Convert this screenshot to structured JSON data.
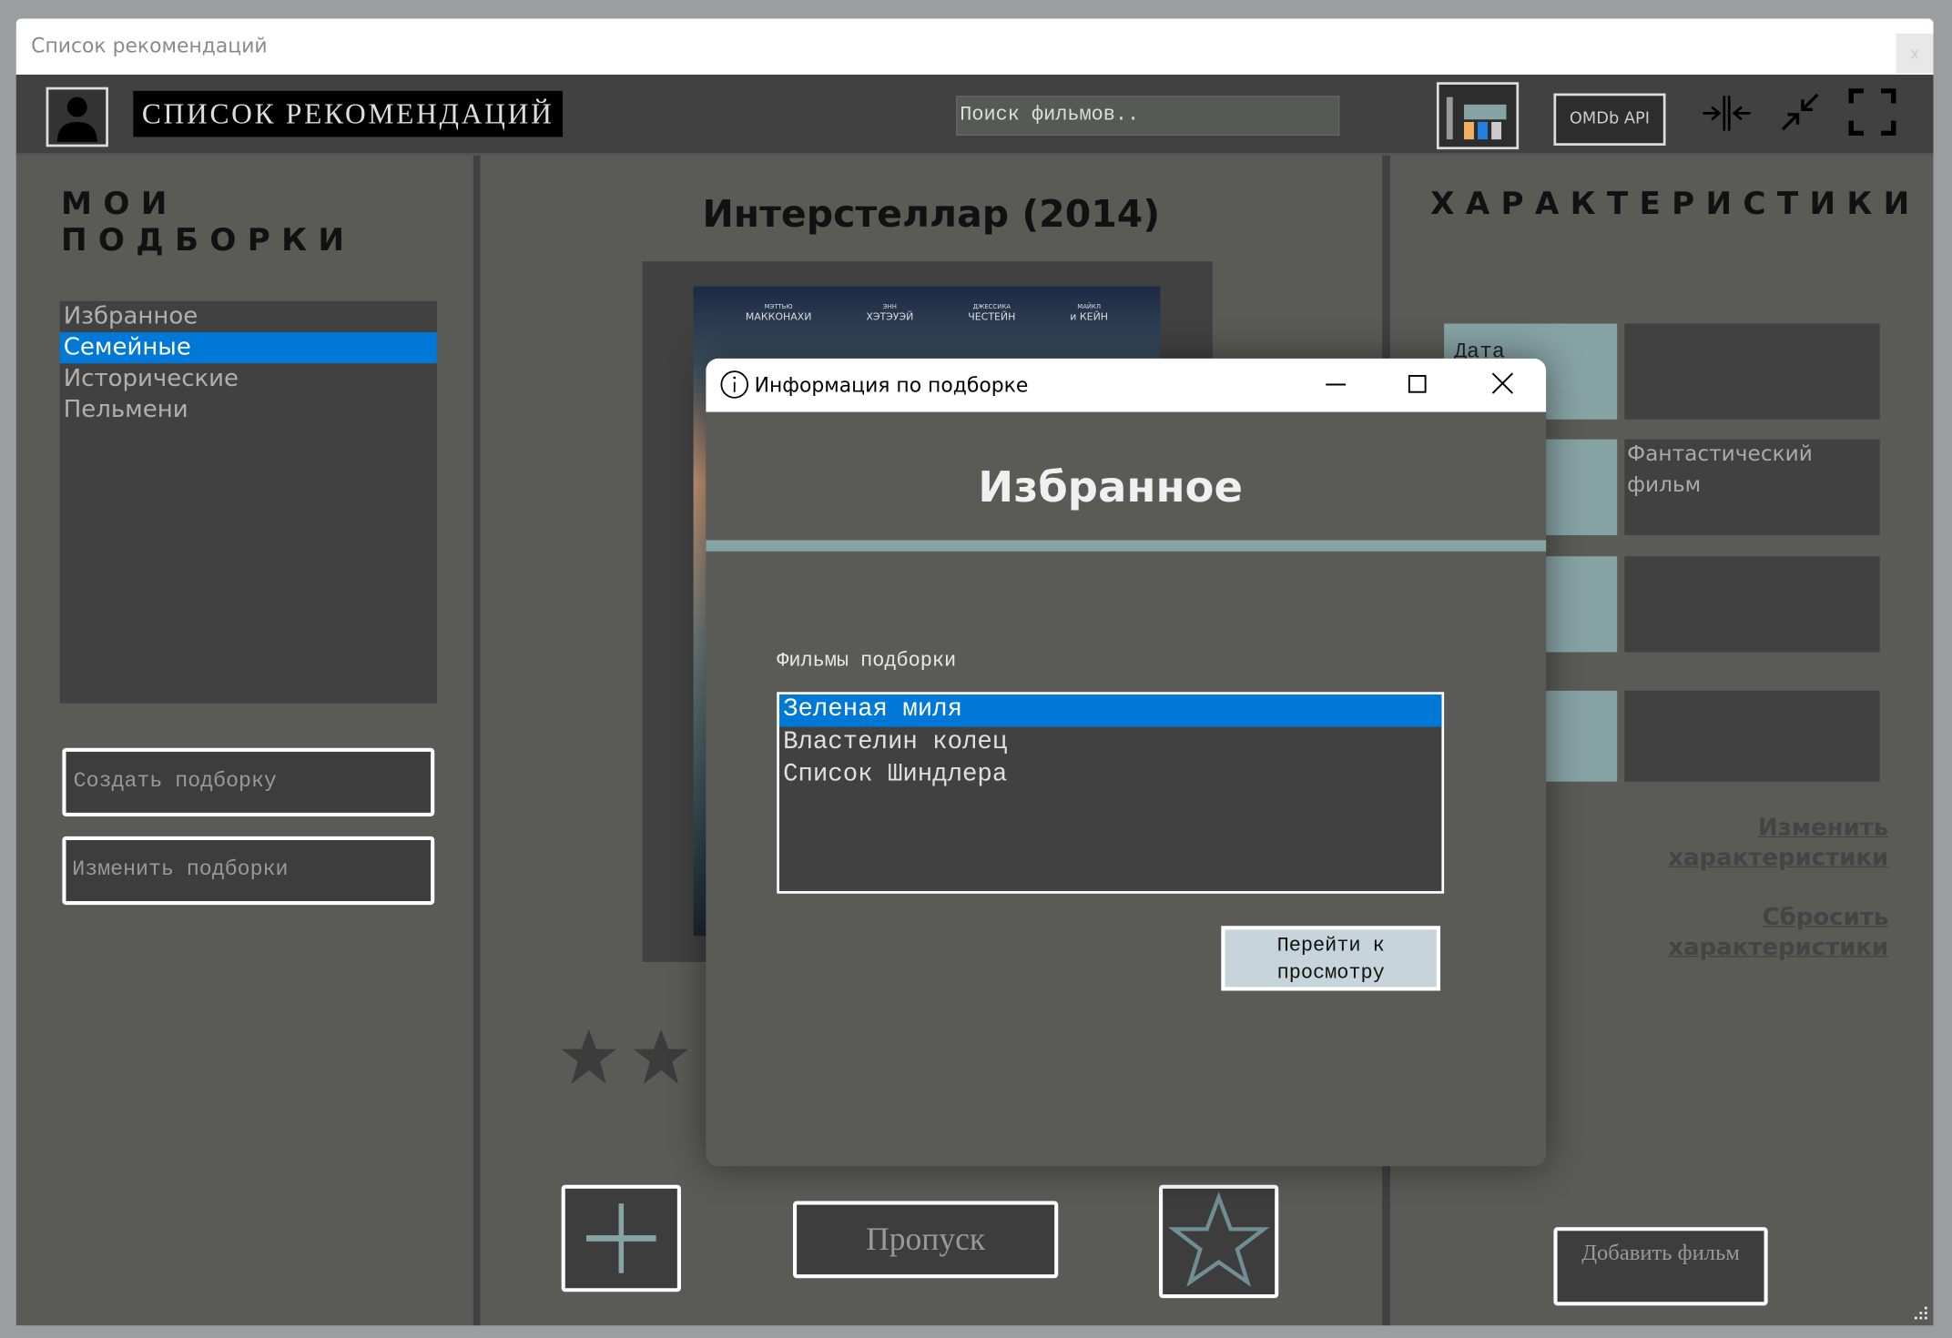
{
  "window": {
    "title": "Список рекомендаций",
    "close": "x"
  },
  "toolbar": {
    "logo": "СПИСОК РЕКОМЕНДАЦИЙ",
    "search_placeholder": "Поиск фильмов..",
    "omdb": "OMDb API"
  },
  "left": {
    "heading": "МОИ ПОДБОРКИ",
    "items": [
      "Избранное",
      "Семейные",
      "Исторические",
      "Пельмени"
    ],
    "selected": 1,
    "create": "Создать подборку",
    "edit": "Изменить подборки"
  },
  "center": {
    "title": "Интерстеллар (2014)",
    "poster_credits": [
      {
        "first": "МЭТТЬЮ",
        "last": "МАККОНАХИ"
      },
      {
        "first": "ЭНН",
        "last": "ХЭТЭУЭЙ"
      },
      {
        "first": "ДЖЕССИКА",
        "last": "ЧЕСТЕЙН"
      },
      {
        "first": "МАЙКЛ",
        "last": "и КЕЙН"
      }
    ],
    "visible_stars": 2,
    "skip": "Пропуск"
  },
  "right": {
    "heading": "ХАРАКТЕРИСТИКИ",
    "rows": [
      {
        "label": "Дата",
        "value": ""
      },
      {
        "label": "",
        "value": "Фантастический фильм"
      },
      {
        "label": "",
        "value": ""
      },
      {
        "label": "",
        "value": ""
      }
    ],
    "edit_link": "Изменить характеристики",
    "reset_link": "Сбросить характеристики",
    "add": "Добавить фильм"
  },
  "dialog": {
    "title": "Информация по подборке",
    "name": "Избранное",
    "films_label": "Фильмы подборки",
    "films": [
      "Зеленая миля",
      "Властелин колец",
      "Список Шиндлера"
    ],
    "selected": 0,
    "go": "Перейти к просмотру"
  },
  "colors": {
    "accent": "#0078d7",
    "panel": "#5a5b56",
    "dark": "#414141",
    "teal": "#86a3a6"
  }
}
